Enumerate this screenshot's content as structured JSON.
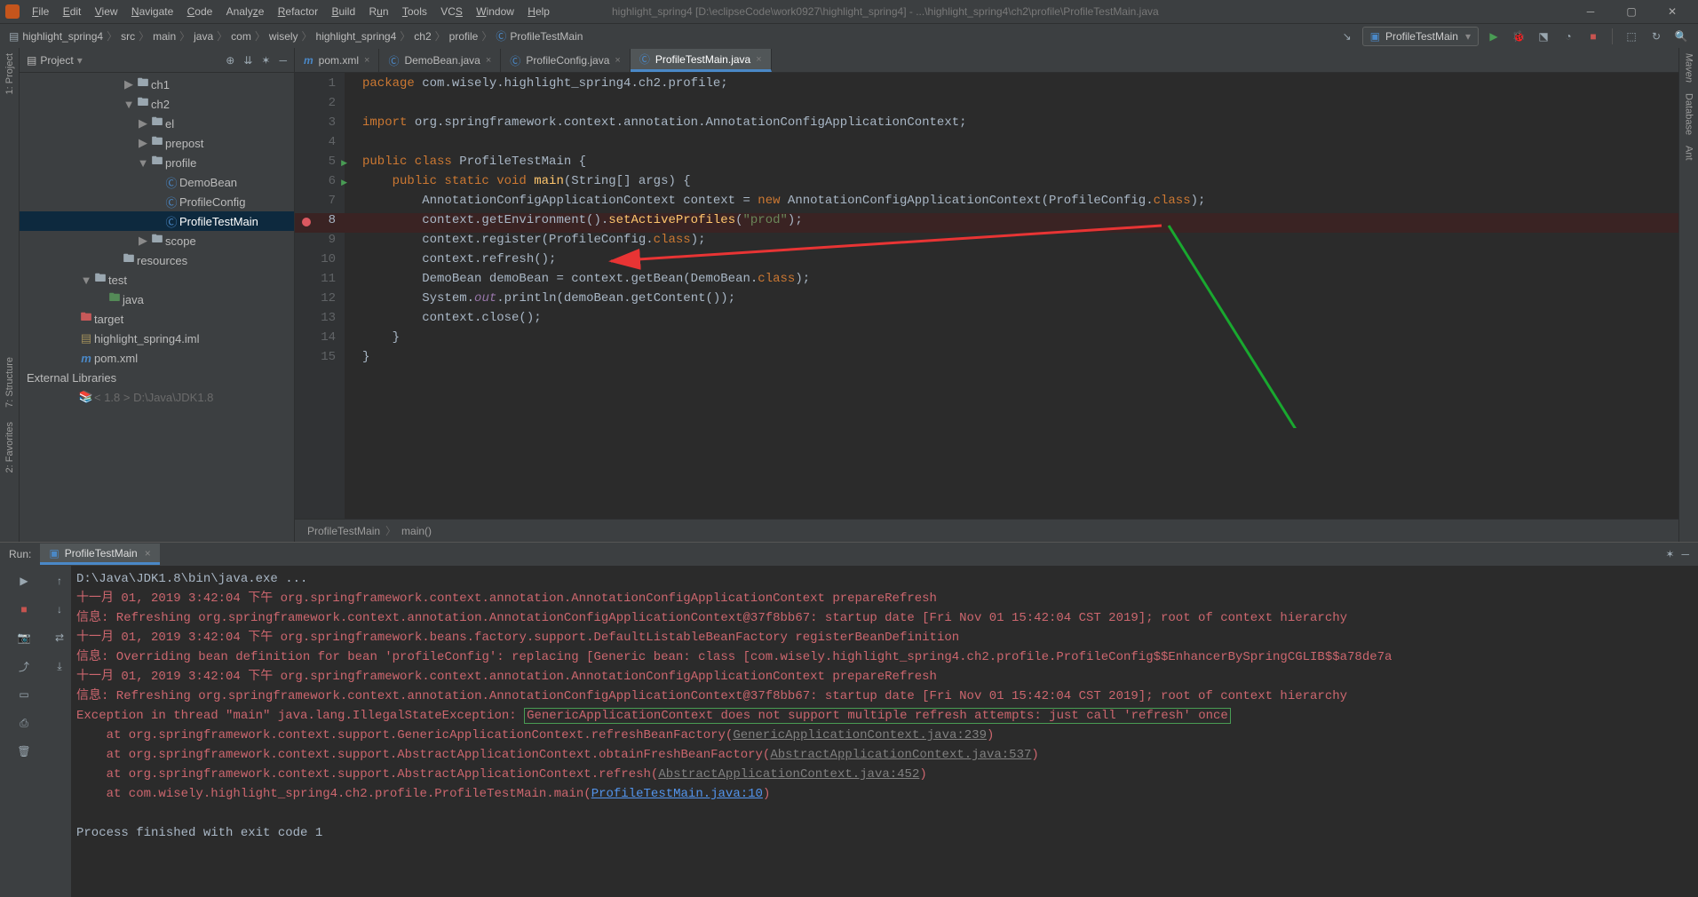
{
  "window": {
    "title": "highlight_spring4 [D:\\eclipseCode\\work0927\\highlight_spring4] - ...\\highlight_spring4\\ch2\\profile\\ProfileTestMain.java"
  },
  "menu": [
    "File",
    "Edit",
    "View",
    "Navigate",
    "Code",
    "Analyze",
    "Refactor",
    "Build",
    "Run",
    "Tools",
    "VCS",
    "Window",
    "Help"
  ],
  "breadcrumbs": [
    "highlight_spring4",
    "src",
    "main",
    "java",
    "com",
    "wisely",
    "highlight_spring4",
    "ch2",
    "profile",
    "ProfileTestMain"
  ],
  "runconfig": "ProfileTestMain",
  "project": {
    "title": "Project",
    "items": [
      {
        "d": 4,
        "arrow": "▶",
        "icon": "folder",
        "label": "ch1"
      },
      {
        "d": 4,
        "arrow": "▼",
        "icon": "folder",
        "label": "ch2"
      },
      {
        "d": 5,
        "arrow": "▶",
        "icon": "folder",
        "label": "el"
      },
      {
        "d": 5,
        "arrow": "▶",
        "icon": "folder",
        "label": "prepost"
      },
      {
        "d": 5,
        "arrow": "▼",
        "icon": "folder",
        "label": "profile"
      },
      {
        "d": 6,
        "arrow": "",
        "icon": "class",
        "label": "DemoBean"
      },
      {
        "d": 6,
        "arrow": "",
        "icon": "class",
        "label": "ProfileConfig"
      },
      {
        "d": 6,
        "arrow": "",
        "icon": "class",
        "label": "ProfileTestMain",
        "sel": true
      },
      {
        "d": 5,
        "arrow": "▶",
        "icon": "folder",
        "label": "scope"
      },
      {
        "d": 3,
        "arrow": "",
        "icon": "folder",
        "label": "resources"
      },
      {
        "d": 1,
        "arrow": "▼",
        "icon": "folder",
        "label": "test"
      },
      {
        "d": 2,
        "arrow": "",
        "icon": "pkg",
        "label": "java"
      },
      {
        "d": 0,
        "arrow": "",
        "icon": "tgt",
        "label": "target"
      },
      {
        "d": 0,
        "arrow": "",
        "icon": "file",
        "label": "highlight_spring4.iml"
      },
      {
        "d": 0,
        "arrow": "",
        "icon": "mvn",
        "label": "pom.xml"
      },
      {
        "d": -1,
        "arrow": "",
        "icon": "",
        "label": "External Libraries"
      },
      {
        "d": 0,
        "arrow": "",
        "icon": "lib",
        "label": "< 1.8 >  D:\\Java\\JDK1.8"
      }
    ]
  },
  "tabs": [
    {
      "label": "pom.xml",
      "icon": "mvn"
    },
    {
      "label": "DemoBean.java",
      "icon": "class"
    },
    {
      "label": "ProfileConfig.java",
      "icon": "class"
    },
    {
      "label": "ProfileTestMain.java",
      "icon": "class",
      "active": true
    }
  ],
  "code": {
    "lines": [
      1,
      2,
      3,
      4,
      5,
      6,
      7,
      8,
      9,
      10,
      11,
      12,
      13,
      14,
      15
    ],
    "breakpoint": 8,
    "runnable": [
      5,
      6
    ]
  },
  "editor_status": {
    "cls": "ProfileTestMain",
    "mth": "main()"
  },
  "run": {
    "label": "Run:",
    "tab": "ProfileTestMain"
  },
  "console": {
    "cmd": "D:\\Java\\JDK1.8\\bin\\java.exe ...",
    "l1": "十一月 01, 2019 3:42:04 下午 org.springframework.context.annotation.AnnotationConfigApplicationContext prepareRefresh",
    "l2": "信息: Refreshing org.springframework.context.annotation.AnnotationConfigApplicationContext@37f8bb67: startup date [Fri Nov 01 15:42:04 CST 2019]; root of context hierarchy",
    "l3": "十一月 01, 2019 3:42:04 下午 org.springframework.beans.factory.support.DefaultListableBeanFactory registerBeanDefinition",
    "l4": "信息: Overriding bean definition for bean 'profileConfig': replacing [Generic bean: class [com.wisely.highlight_spring4.ch2.profile.ProfileConfig$$EnhancerBySpringCGLIB$$a78de7a",
    "l5": "十一月 01, 2019 3:42:04 下午 org.springframework.context.annotation.AnnotationConfigApplicationContext prepareRefresh",
    "l6": "信息: Refreshing org.springframework.context.annotation.AnnotationConfigApplicationContext@37f8bb67: startup date [Fri Nov 01 15:42:04 CST 2019]; root of context hierarchy",
    "e_pre": "Exception in thread \"main\" java.lang.IllegalStateException: ",
    "e_msg": "GenericApplicationContext does not support multiple refresh attempts: just call 'refresh' once",
    "st": [
      {
        "pre": "    at org.springframework.context.support.GenericApplicationContext.refreshBeanFactory(",
        "link": "GenericApplicationContext.java:239",
        "post": ")"
      },
      {
        "pre": "    at org.springframework.context.support.AbstractApplicationContext.obtainFreshBeanFactory(",
        "link": "AbstractApplicationContext.java:537",
        "post": ")"
      },
      {
        "pre": "    at org.springframework.context.support.AbstractApplicationContext.refresh(",
        "link": "AbstractApplicationContext.java:452",
        "post": ")"
      },
      {
        "pre": "    at com.wisely.highlight_spring4.ch2.profile.ProfileTestMain.main(",
        "link": "ProfileTestMain.java:10",
        "post": ")",
        "blue": true
      }
    ],
    "exit": "Process finished with exit code 1"
  },
  "leftstrip": [
    "2: Favorites",
    "7: Structure",
    "1: Project"
  ],
  "rightstrip": [
    "Maven",
    "Database",
    "Ant"
  ]
}
